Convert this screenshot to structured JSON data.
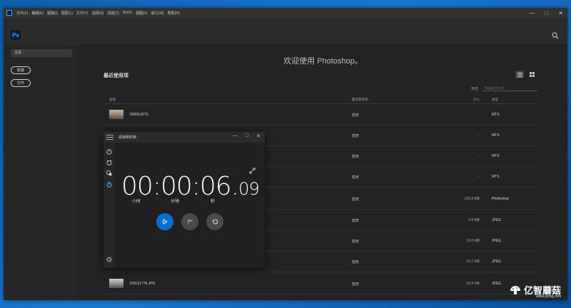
{
  "menubar": {
    "items": [
      "文件(F)",
      "编辑(E)",
      "图像(I)",
      "图层(L)",
      "文字(Y)",
      "选择(S)",
      "滤镜(T)",
      "3D(D)",
      "视图(V)",
      "窗口(W)",
      "帮助(H)"
    ],
    "minimize": "—",
    "maximize": "□",
    "close": "✕"
  },
  "app": {
    "logo": "Ps"
  },
  "sidebar": {
    "home_label": "主页",
    "new_label": "新建",
    "open_label": "打开"
  },
  "main": {
    "welcome": "欢迎使用 Photoshop。",
    "recent_title": "最近使用项",
    "filter_label": "筛选",
    "filter_placeholder": "筛选最近的文件"
  },
  "table": {
    "headers": {
      "name": "名称",
      "date": "最近使用项",
      "size": "大小",
      "type": "类型"
    },
    "rows": [
      {
        "name": "00006.MTS",
        "date": "前天",
        "size": "-",
        "type": "MTS"
      },
      {
        "name": "",
        "date": "前天",
        "size": "-",
        "type": "MTS"
      },
      {
        "name": "",
        "date": "前天",
        "size": "-",
        "type": "MTS"
      },
      {
        "name": "",
        "date": "前天",
        "size": "-",
        "type": "MTS"
      },
      {
        "name": "",
        "date": "前天",
        "size": "120.8 MB",
        "type": "Photoshop"
      },
      {
        "name": "",
        "date": "前天",
        "size": "9.8 MB",
        "type": "JPEG"
      },
      {
        "name": "",
        "date": "前天",
        "size": "10.6 MB",
        "type": "JPEG"
      },
      {
        "name": "",
        "date": "前天",
        "size": "10.1 MB",
        "type": "JPEG"
      },
      {
        "name": "DSC01776.JPG",
        "date": "前天",
        "size": "10.9 MB",
        "type": "JPEG"
      }
    ]
  },
  "timer": {
    "title": "闹钟和时钟",
    "minimize": "—",
    "maximize": "□",
    "close": "✕",
    "hours": "00",
    "minutes": "00",
    "seconds": "06",
    "centiseconds": "09",
    "unit_hours": "小时",
    "unit_minutes": "分钟",
    "unit_seconds": "秒"
  },
  "watermark": {
    "text": "亿智蘑菇",
    "url": "www.yzmg.com"
  },
  "colors": {
    "accent": "#0a6ed1",
    "ps_blue": "#31a8ff",
    "desktop": "#1a78d2"
  }
}
